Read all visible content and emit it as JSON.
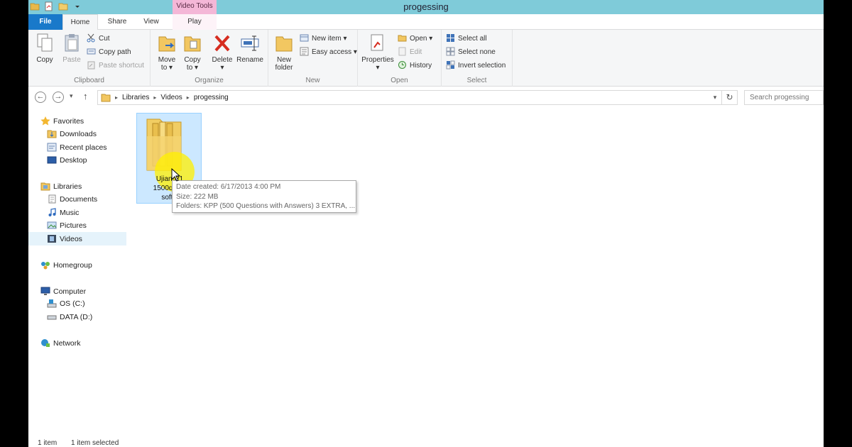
{
  "window": {
    "title": "progessing",
    "context_tab_header": "Video Tools",
    "colors": {
      "titlebar": "#7fcbd9",
      "file_tab": "#1979ca",
      "context_tab": "#f4b7d7",
      "selection": "#cce8ff",
      "highlight": "#fff000"
    }
  },
  "tabs": {
    "file": "File",
    "home": "Home",
    "share": "Share",
    "view": "View",
    "play": "Play"
  },
  "ribbon": {
    "clipboard": {
      "label": "Clipboard",
      "copy": "Copy",
      "paste": "Paste",
      "cut": "Cut",
      "copy_path": "Copy path",
      "paste_shortcut": "Paste shortcut"
    },
    "organize": {
      "label": "Organize",
      "move_to_1": "Move",
      "move_to_2": "to ▾",
      "copy_to_1": "Copy",
      "copy_to_2": "to ▾",
      "delete": "Delete",
      "delete_arrow": "▾",
      "rename": "Rename"
    },
    "new": {
      "label": "New",
      "new_folder_1": "New",
      "new_folder_2": "folder",
      "new_item": "New item ▾",
      "easy_access": "Easy access ▾"
    },
    "open": {
      "label": "Open",
      "properties": "Properties",
      "properties_arrow": "▾",
      "open": "Open ▾",
      "edit": "Edit",
      "history": "History"
    },
    "select": {
      "label": "Select",
      "select_all": "Select all",
      "select_none": "Select none",
      "invert_selection": "Invert selection"
    }
  },
  "address": {
    "back": "←",
    "forward": "→",
    "recent": "▾",
    "up": "↑",
    "path": [
      "Libraries",
      "Videos",
      "progessing"
    ],
    "separator": "▸",
    "refresh": "↻",
    "search_placeholder": "Search progessing"
  },
  "nav": {
    "favorites": "Favorites",
    "downloads": "Downloads",
    "recent_places": "Recent places",
    "desktop": "Desktop",
    "libraries": "Libraries",
    "documents": "Documents",
    "music": "Music",
    "pictures": "Pictures",
    "videos": "Videos",
    "homegroup": "Homegroup",
    "computer": "Computer",
    "os_c": "OS (C:)",
    "data_d": "DATA (D:)",
    "network": "Network"
  },
  "content": {
    "folder_name_1": "Ujian-P1",
    "folder_name_2": "1500quest",
    "folder_name_3": "softw",
    "tooltip": {
      "date_created": "Date created: 6/17/2013 4:00 PM",
      "size": "Size: 222 MB",
      "folders": "Folders: KPP (500 Questions with Answers) 3 EXTRA, ..."
    }
  },
  "status": {
    "item_count": "1 item",
    "selected": "1 item selected"
  }
}
